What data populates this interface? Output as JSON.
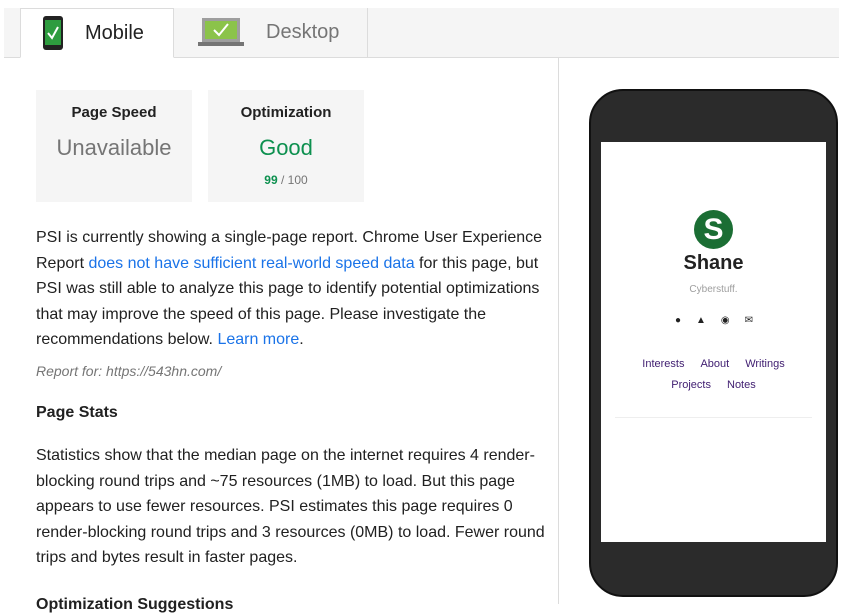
{
  "tabs": {
    "mobile": "Mobile",
    "desktop": "Desktop"
  },
  "cards": {
    "speed": {
      "title": "Page Speed",
      "value": "Unavailable"
    },
    "opt": {
      "title": "Optimization",
      "value": "Good",
      "score": "99",
      "score_suffix": " / 100"
    }
  },
  "intro": {
    "text1": "PSI is currently showing a single-page report. Chrome User Experience Report ",
    "link1": "does not have sufficient real-world speed data",
    "text2": " for this page, but PSI was still able to analyze this page to identify potential optimizations that may improve the speed of this page. Please investigate the recommendations below. ",
    "link2": "Learn more",
    "text3": "."
  },
  "report_for": "Report for: https://543hn.com/",
  "stats": {
    "heading": "Page Stats",
    "body": "Statistics show that the median page on the internet requires 4 render-blocking round trips and ~75 resources (1MB) to load. But this page appears to use fewer resources. PSI estimates this page requires 0 render-blocking round trips and 3 resources (0MB) to load. Fewer round trips and bytes result in faster pages."
  },
  "next_heading": "Optimization Suggestions",
  "preview": {
    "logo_letter": "S",
    "name": "Shane",
    "tagline": "Cyberstuff.",
    "nav_row1": [
      "Interests",
      "About",
      "Writings"
    ],
    "nav_row2": [
      "Projects",
      "Notes"
    ],
    "social_icons": [
      "github-icon",
      "gitlab-icon",
      "reddit-icon",
      "email-icon"
    ]
  }
}
